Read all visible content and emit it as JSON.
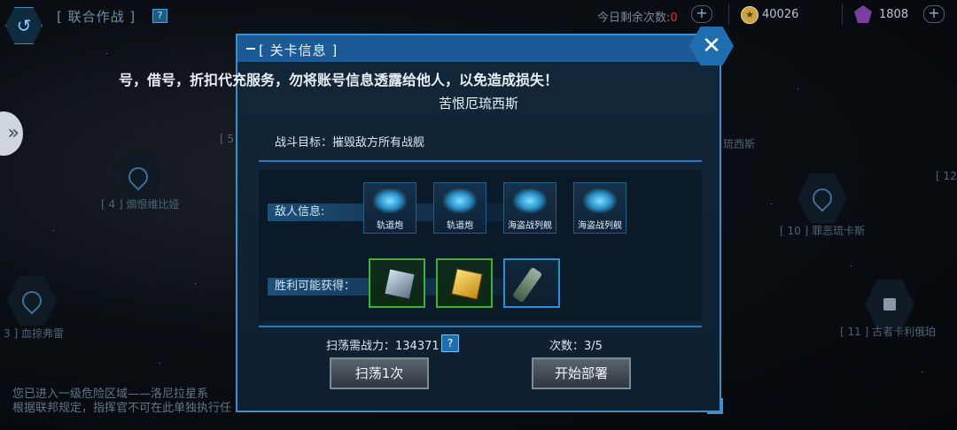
{
  "top_bar": {
    "title": "[ 联合作战 ]",
    "help_icon": "?",
    "attempts_label": "今日剩余次数:",
    "attempts_value": "0",
    "gold_value": "40026",
    "gem_value": "1808"
  },
  "map_nodes": [
    {
      "label": "[ 4 ] 煽恨维比娅"
    },
    {
      "label": "[ 5 ]"
    },
    {
      "label": "琉西斯"
    },
    {
      "label": "[ 10 ] 罪恶琉卡斯"
    },
    {
      "label": "3 ] 血掠弗雷"
    },
    {
      "label": "[ 11 ] 古者卡利俄珀"
    },
    {
      "label": "[ 12"
    }
  ],
  "bottom_messages": [
    "您已进入一级危险区域——洛尼拉星系",
    "根据联邦规定，指挥官不可在此单独执行任"
  ],
  "notice_marquee": "号，借号，折扣代充服务，勿将账号信息透露给他人，以免造成损失！",
  "dialog": {
    "title": "[ 关卡信息 ]",
    "close_glyph": "✕",
    "stage_name": "苦恨厄琉西斯",
    "objective": "战斗目标：摧毁敌方所有战舰",
    "enemy_label": "敌人信息:",
    "enemies": [
      {
        "name": "轨道炮"
      },
      {
        "name": "轨道炮"
      },
      {
        "name": "海盗战列舰"
      },
      {
        "name": "海盗战列舰"
      }
    ],
    "reward_label": "胜利可能获得：",
    "rewards": [
      {
        "icon": "gray-cube-icon",
        "rarity": "green"
      },
      {
        "icon": "gold-cube-icon",
        "rarity": "green"
      },
      {
        "icon": "missile-part-icon",
        "rarity": "blue"
      }
    ],
    "sweep_power_label": "扫荡需战力：",
    "sweep_power_value": "134371",
    "count_label": "次数：",
    "count_value": "3/5",
    "sweep_button": "扫荡1次",
    "deploy_button": "开始部署"
  },
  "colors": {
    "accent": "#3e8ed0",
    "header": "#1c5a95",
    "reward_green": "#3fb23a",
    "reward_blue": "#2e8fd6",
    "alert_red": "#dd3333"
  }
}
